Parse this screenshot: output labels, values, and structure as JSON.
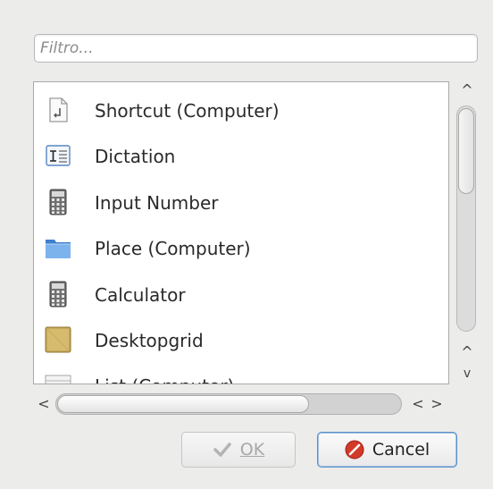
{
  "filter": {
    "placeholder": "Filtro..."
  },
  "list": {
    "items": [
      {
        "label": "Shortcut (Computer)",
        "icon": "shortcut-icon"
      },
      {
        "label": "Dictation",
        "icon": "dictation-icon"
      },
      {
        "label": "Input Number",
        "icon": "calculator-icon"
      },
      {
        "label": "Place (Computer)",
        "icon": "folder-icon"
      },
      {
        "label": "Calculator",
        "icon": "calculator-icon"
      },
      {
        "label": "Desktopgrid",
        "icon": "desktopgrid-icon"
      },
      {
        "label": "List (Computer)",
        "icon": "list-icon"
      }
    ]
  },
  "scrollbars": {
    "up_arrow": "^",
    "down_arrow": "v",
    "left_arrow": "<",
    "right_arrow": ">"
  },
  "buttons": {
    "ok_label": "OK",
    "cancel_label": "Cancel"
  },
  "colors": {
    "accent_border": "#5d91c4",
    "folder_blue": "#4f8fd6",
    "cancel_icon_red": "#d23a2a"
  }
}
